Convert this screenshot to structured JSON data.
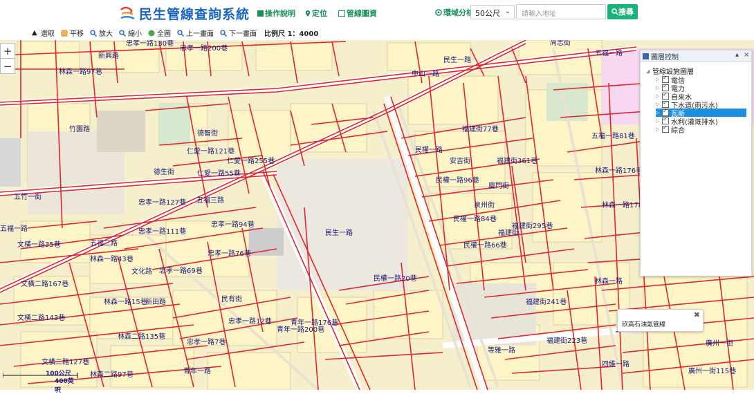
{
  "header": {
    "title": "民生管線查詢系統",
    "nav": [
      {
        "label": "操作說明",
        "icon": "book-icon"
      },
      {
        "label": "定位",
        "icon": "location-pin-icon"
      },
      {
        "label": "管線圖資",
        "icon": "image-icon"
      }
    ],
    "radius_label": "環域分析",
    "radius_value": "50公尺",
    "address_placeholder": "請輸入地址",
    "search_label": "搜尋"
  },
  "toolbar": {
    "tools": [
      {
        "label": "選取",
        "icon": "cursor-icon"
      },
      {
        "label": "平移",
        "icon": "hand-icon"
      },
      {
        "label": "放大",
        "icon": "zoom-in-icon"
      },
      {
        "label": "縮小",
        "icon": "zoom-out-icon"
      },
      {
        "label": "全圖",
        "icon": "globe-icon"
      },
      {
        "label": "上一畫面",
        "icon": "prev-view-icon"
      },
      {
        "label": "下一畫面",
        "icon": "next-view-icon"
      }
    ],
    "scale_text": "比例尺 1：4000"
  },
  "zoom": {
    "in": "+",
    "out": "−"
  },
  "layer_panel": {
    "title": "圖層控制",
    "root": "管線設施圖層",
    "layers": [
      {
        "label": "電信",
        "checked": true,
        "selected": false
      },
      {
        "label": "電力",
        "checked": true,
        "selected": false
      },
      {
        "label": "自來水",
        "checked": true,
        "selected": false
      },
      {
        "label": "下水道(雨污水)",
        "checked": true,
        "selected": false
      },
      {
        "label": "瓦斯",
        "checked": true,
        "selected": true
      },
      {
        "label": "水利(灌溉排水)",
        "checked": true,
        "selected": false
      },
      {
        "label": "綜合",
        "checked": true,
        "selected": false
      }
    ]
  },
  "popup": {
    "text": "欣高石油氣管線"
  },
  "scalebar": {
    "top": "100公尺",
    "bottom": "400英呎"
  },
  "map_labels": [
    "忠孝一路130巷",
    "忠孝一路200巷",
    "新興路",
    "林森一路97巷",
    "民生一路",
    "尚志街",
    "中山一路",
    "五福一路",
    "竹園路",
    "德智街",
    "仁愛一路121巷",
    "仁愛一路255巷",
    "五福三路",
    "德生街",
    "忠孝一路127巷",
    "仁愛一路55巷",
    "五福二路",
    "五竹一街",
    "文橫一路35巷",
    "五福一路",
    "忠孝一路111巷",
    "忠孝一路94巷",
    "忠孝一路76巷",
    "文橫二路167巷",
    "林森一路43巷",
    "文化路",
    "林森一路15巷",
    "新田路",
    "文橫二路143巷",
    "林森二路135巷",
    "忠孝一路69巷",
    "文橫二路127巷",
    "林森二路97巷",
    "青年一路",
    "民生一路",
    "民權一路",
    "民權一路96巷",
    "民權一路84巷",
    "民權一路66巷",
    "民權一路20巷",
    "安吉街",
    "廈門街",
    "泉州街",
    "福建街",
    "福建街77巷",
    "福建街361巷",
    "福建街295巷",
    "福建街241巷",
    "福建街223巷",
    "廣州一街115巷",
    "青年一路176巷",
    "忠孝一路12巷",
    "忠孝一路7巷",
    "民有街",
    "青年一路200巷",
    "等雅一路",
    "林森一路",
    "五福一路81巷",
    "林森一路176巷",
    "林森一路178巷",
    "四維一路",
    "廣州一街"
  ]
}
